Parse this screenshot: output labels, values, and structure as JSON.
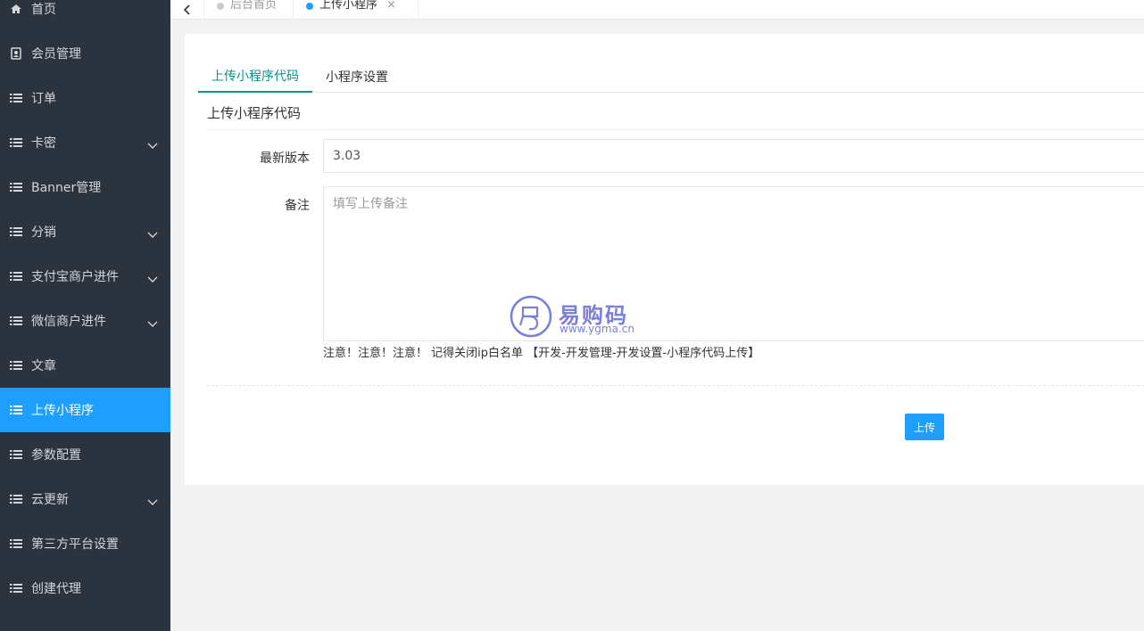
{
  "sidebar": {
    "items": [
      {
        "label": "首页",
        "icon": "home-icon",
        "expandable": false,
        "active": false
      },
      {
        "label": "会员管理",
        "icon": "contact-icon",
        "expandable": false,
        "active": false
      },
      {
        "label": "订单",
        "icon": "list-icon",
        "expandable": false,
        "active": false
      },
      {
        "label": "卡密",
        "icon": "list-icon",
        "expandable": true,
        "active": false
      },
      {
        "label": "Banner管理",
        "icon": "list-icon",
        "expandable": false,
        "active": false
      },
      {
        "label": "分销",
        "icon": "list-icon",
        "expandable": true,
        "active": false
      },
      {
        "label": "支付宝商户进件",
        "icon": "list-icon",
        "expandable": true,
        "active": false
      },
      {
        "label": "微信商户进件",
        "icon": "list-icon",
        "expandable": true,
        "active": false
      },
      {
        "label": "文章",
        "icon": "list-icon",
        "expandable": false,
        "active": false
      },
      {
        "label": "上传小程序",
        "icon": "list-icon",
        "expandable": false,
        "active": true
      },
      {
        "label": "参数配置",
        "icon": "list-icon",
        "expandable": false,
        "active": false
      },
      {
        "label": "云更新",
        "icon": "list-icon",
        "expandable": true,
        "active": false
      },
      {
        "label": "第三方平台设置",
        "icon": "list-icon",
        "expandable": false,
        "active": false
      },
      {
        "label": "创建代理",
        "icon": "list-icon",
        "expandable": false,
        "active": false
      }
    ]
  },
  "topbar": {
    "tabs": [
      {
        "label": "后台首页",
        "active": false,
        "dot_color": "#cccccc"
      },
      {
        "label": "上传小程序",
        "active": true,
        "dot_color": "#1e9fff"
      }
    ],
    "close_glyph": "×"
  },
  "content": {
    "tabs": [
      {
        "label": "上传小程序代码",
        "active": true
      },
      {
        "label": "小程序设置",
        "active": false
      }
    ],
    "section_title": "上传小程序代码",
    "version_label": "最新版本",
    "version_value": "3.03",
    "remark_label": "备注",
    "remark_placeholder": "填写上传备注",
    "notice": "注意！注意！注意！ 记得关闭ip白名单 【开发-开发管理-开发设置-小程序代码上传】",
    "submit_label": "上传"
  },
  "watermark": {
    "brand": "易购码",
    "url": "www.ygma.cn"
  },
  "colors": {
    "sidebar_bg": "#2a333e",
    "active_blue": "#1e9fff",
    "tab_green": "#009688"
  }
}
